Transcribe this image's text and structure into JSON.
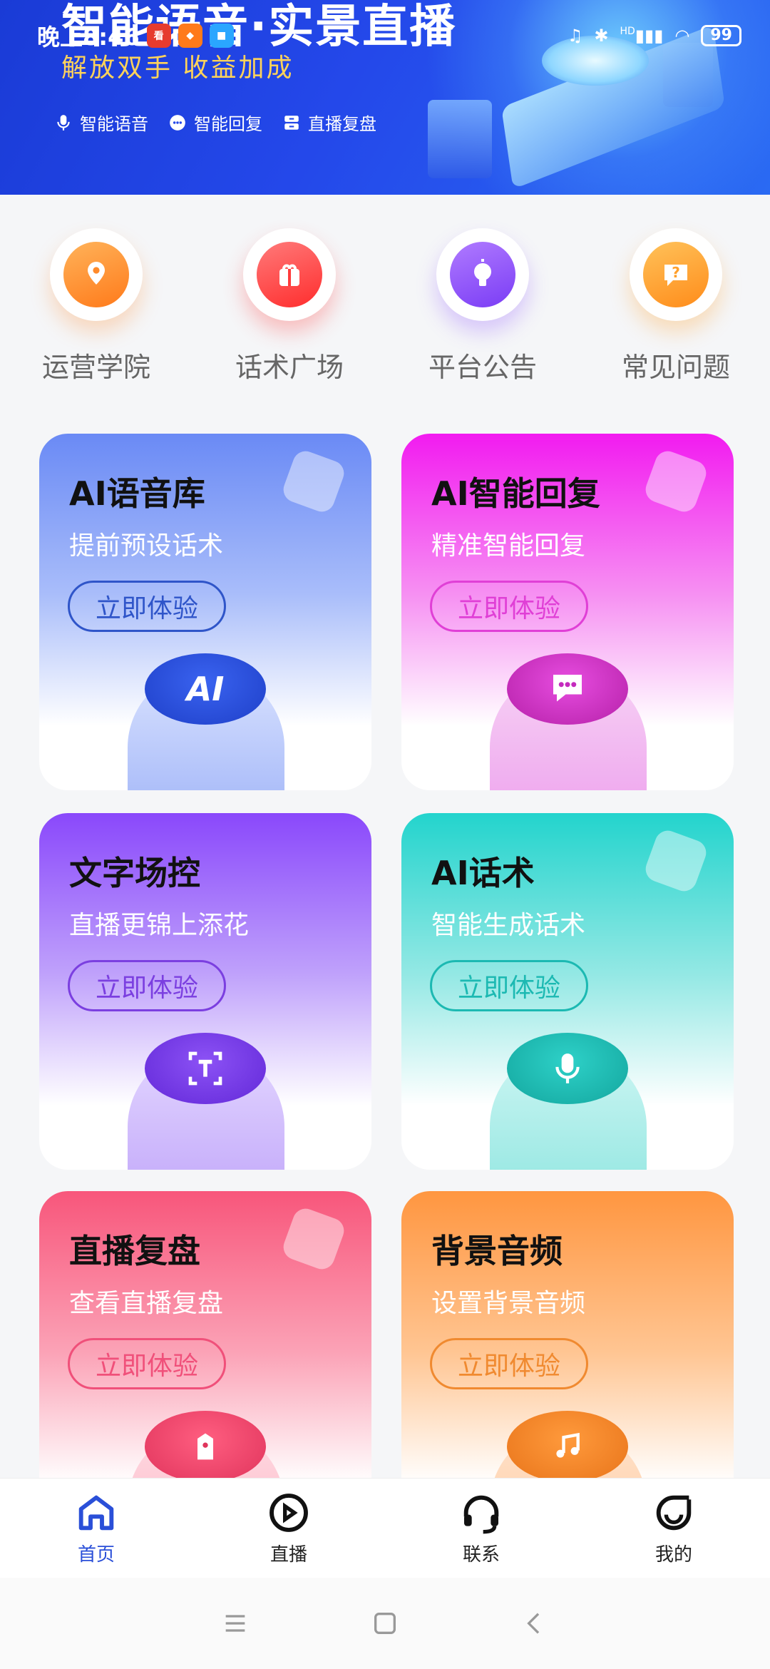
{
  "status_bar": {
    "time": "晚上8:46",
    "battery": "99",
    "network": "HD"
  },
  "banner": {
    "title": "智能语音·实景直播",
    "subtitle": "解放双手 收益加成",
    "features": [
      "智能语音",
      "智能回复",
      "直播复盘"
    ]
  },
  "quick_menu": [
    {
      "label": "运营学院",
      "icon": "location-icon",
      "color": "#ff8a2a"
    },
    {
      "label": "话术广场",
      "icon": "gift-box-icon",
      "color": "#ff3b3b"
    },
    {
      "label": "平台公告",
      "icon": "lightbulb-icon",
      "color": "#8a4bff"
    },
    {
      "label": "常见问题",
      "icon": "question-icon",
      "color": "#ff9f2a"
    }
  ],
  "cards": [
    {
      "title": "AI语音库",
      "subtitle": "提前预设话术",
      "button": "立即体验",
      "icon": "ai-icon",
      "color": "#6d8df5"
    },
    {
      "title": "AI智能回复",
      "subtitle": "精准智能回复",
      "button": "立即体验",
      "icon": "chat-bubble-icon",
      "color": "#f21bf0"
    },
    {
      "title": "文字场控",
      "subtitle": "直播更锦上添花",
      "button": "立即体验",
      "icon": "text-icon",
      "color": "#8a48fb"
    },
    {
      "title": "AI话术",
      "subtitle": "智能生成话术",
      "button": "立即体验",
      "icon": "microphone-icon",
      "color": "#23d4cd"
    },
    {
      "title": "直播复盘",
      "subtitle": "查看直播复盘",
      "button": "立即体验",
      "icon": "review-icon",
      "color": "#f8567b"
    },
    {
      "title": "背景音频",
      "subtitle": "设置背景音频",
      "button": "立即体验",
      "icon": "music-note-icon",
      "color": "#ff9640"
    }
  ],
  "bottom_nav": [
    {
      "label": "首页",
      "icon": "home-icon",
      "active": true
    },
    {
      "label": "直播",
      "icon": "play-circle-icon",
      "active": false
    },
    {
      "label": "联系",
      "icon": "headset-icon",
      "active": false
    },
    {
      "label": "我的",
      "icon": "smile-icon",
      "active": false
    }
  ]
}
